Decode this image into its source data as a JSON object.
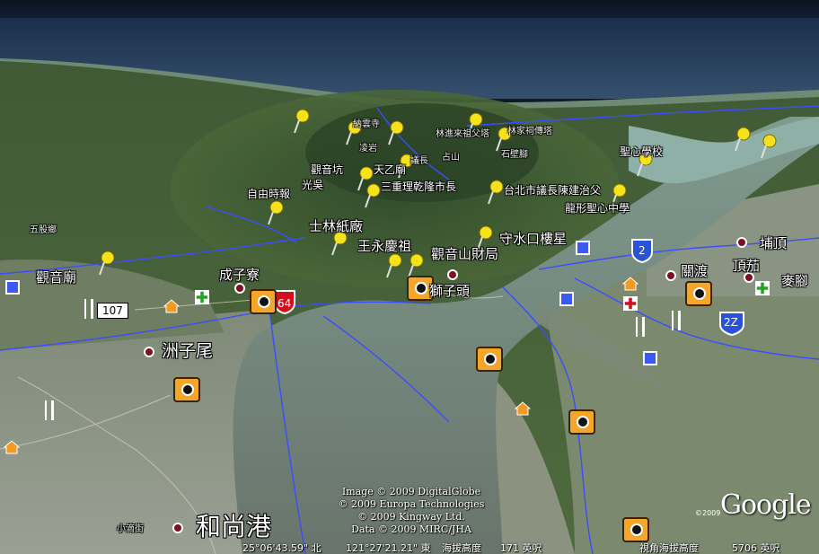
{
  "map": {
    "app": "Google Earth",
    "view": "3D oblique aerial view of a river mouth",
    "places": {
      "guanyin_temple": "觀音廟",
      "wugu": "五股鄉",
      "zhouziwei": "洲子尾",
      "chengziliao": "成子寮",
      "shilin_paper": "士林紙廠",
      "wang_yongqing": "王永慶祖",
      "guanyinshan_cai": "觀音山財局",
      "shoushuikou": "守水口樓星",
      "shizitou": "獅子頭",
      "heshanggang": "和尚港",
      "guandu": "關渡",
      "dingjia": "頂茄",
      "puding": "埔頂",
      "mailiao": "麥腳",
      "ziyoushibao": "自由時報",
      "guangyinkeng": "觀音坑",
      "guangwu": "光吳",
      "tianyimiao": "天乙廟",
      "sanchong_mayor": "三重理乾隆市長",
      "taipei_council": "台北市議長陳建治父",
      "longxing_school": "龍形聖心中學",
      "shengxin": "聖心學校",
      "yi_zhang": "議長",
      "shibi": "石壁腳",
      "linjia": "林家祠傳塔",
      "linjinlai": "林進來祖父塔",
      "langyun": "納雲寺",
      "yan": "凌岩",
      "guanyin_mtn": "占山",
      "xiao_dijie": "小滴街",
      "road_107": "107",
      "road_64": "64",
      "road_2": "2",
      "road_2z": "2Z"
    },
    "credits": [
      "Image © 2009 DigitalGlobe",
      "© 2009 Europa Technologies",
      "© 2009 Kingway Ltd.",
      "Data © 2009 MIRC/JHA"
    ],
    "status": {
      "latitude": "25°06'43.59\" 北",
      "longitude": "121°27'21.21\" 東",
      "elevation_label": "海拔高度",
      "elevation_value": "171 英呎",
      "eye_label": "視角海拔高度",
      "eye_value": "5706 英呎"
    },
    "logo": "Google",
    "logo_year": "©2009"
  },
  "icons": {
    "placemark": "yellow-pushpin-icon",
    "photo": "camera-icon",
    "home": "house-icon",
    "hospital": "first-aid-icon",
    "restaurant": "fork-knife-icon",
    "road_shield": "highway-shield-icon"
  },
  "colors": {
    "sea": "#1c2f4b",
    "river": "#8a9f92",
    "land_green": "#4a6a3a",
    "urban": "#8d9386",
    "border_line": "#3c4cff",
    "pin": "#f6e21a",
    "camera": "#f4a62a"
  }
}
